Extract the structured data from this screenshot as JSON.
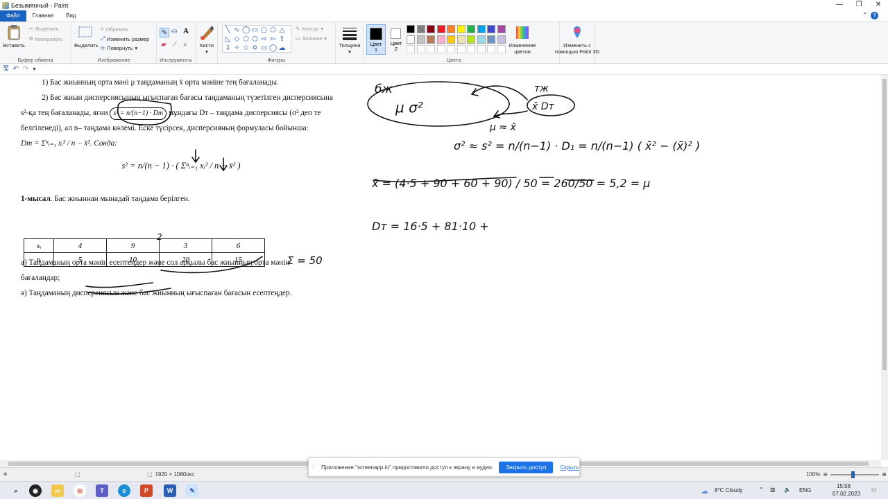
{
  "window": {
    "title": "Безымянный - Paint",
    "controls": [
      "—",
      "❐",
      "✕"
    ]
  },
  "menu": {
    "file": "Файл",
    "home": "Главная",
    "view": "Вид",
    "help": "?"
  },
  "ribbon": {
    "clipboard": {
      "label": "Буфер обмена",
      "paste": "Вставить",
      "cut": "Вырезать",
      "copy": "Копировать"
    },
    "image": {
      "label": "Изображение",
      "select": "Выделить",
      "crop": "Обрезать",
      "resize": "Изменить размер",
      "rotate": "Повернуть"
    },
    "tools": {
      "label": "Инструменты"
    },
    "brushes": {
      "label": "Кисти"
    },
    "shapes": {
      "label": "Фигуры",
      "outline": "Контур",
      "fill": "Заливка"
    },
    "size": {
      "label": "Толщина"
    },
    "color1": {
      "label": "Цвет\n1",
      "line1": "Цвет",
      "line2": "1"
    },
    "color2": {
      "line1": "Цвет",
      "line2": "2"
    },
    "colors": {
      "label": "Цвета",
      "edit_line1": "Изменение",
      "edit_line2": "цветов"
    },
    "paint3d": {
      "line1": "Изменить с",
      "line2": "помощью Paint 3D"
    },
    "palette": [
      "#000000",
      "#7f7f7f",
      "#880015",
      "#ed1c24",
      "#ff7f27",
      "#fff200",
      "#22b14c",
      "#00a2e8",
      "#3f48cc",
      "#a349a4",
      "#ffffff",
      "#c3c3c3",
      "#b97a57",
      "#ffaec9",
      "#ffc90e",
      "#efe4b0",
      "#b5e61d",
      "#99d9ea",
      "#7092be",
      "#c8bfe7"
    ]
  },
  "document": {
    "p1": "1)  Бас жиынның  орта мәні μ таңдаманың  x̄ орта мәніне тең бағаланады.",
    "p2a": "2) Бас жиын дисперсиясының ығыспаған бағасы таңдаманың түзетілген дисперсиясына",
    "p2b_pre": "s²-қа тең бағаланады, яғни ",
    "p2b_formula": "s² = n/(n−1) · Dт",
    "p2b_post": " мұндағы Dт – таңдама дисперсиясы (σ² деп те",
    "p2c": "белгіленеді), ал n– таңдама көлемі. Еске түсірсек, дисперсияның формуласы бойынша:",
    "p2d": "Dт = Σⁿᵢ₌₁ xᵢ² / n − x̄². Сонда:",
    "formula": "s² = n/(n − 1) · ( Σⁿᵢ₌₁ xᵢ² / n − x̄² )",
    "example_bold": "1-мысал",
    "example_rest": ". Бас жиыннан мынадай таңдама берілген.",
    "table": {
      "row1": [
        "xᵢ",
        "4",
        "9",
        "3",
        "6"
      ],
      "row2": [
        "nᵢ",
        "5",
        "10",
        "20",
        "15"
      ]
    },
    "qa": "а)  Таңдаманың орта мәнін есептеңдер және сол арқылы бас жиынның орта мәнін",
    "qa2": "бағалаңдар;",
    "qb": "ә) Таңдаманың дисперсиясын және бас жиынның ығыспаған бағасын есептеңдер."
  },
  "handwriting": {
    "bzh": "бж",
    "tzh": "тж",
    "mu_sigma": "μ  σ²",
    "xbar_dt": "x̄  Dт",
    "mu_eq": "μ ≈ x̄",
    "sigma_eq": "σ² ≈ s² = n/(n−1) · D₁ = n/(n−1) ( x̄² − (x̄)² )",
    "xbar_eq": "x̄ = (4·5 + 90 + 60 + 90) / 50 = 260/50 = 5,2 = μ",
    "dt_eq": "Dт = 16·5 + 81·10 +",
    "sum": "Σ = 50",
    "two": "2"
  },
  "status": {
    "dimensions": "1920 × 1080пкс",
    "zoom": "100%"
  },
  "notification": {
    "text": "Приложение \"screenapp.io\" предоставило доступ к экрану и аудио.",
    "button": "Закрыть доступ",
    "link": "Скрыть"
  },
  "taskbar": {
    "weather": "8°C  Cloudy",
    "lang": "ENG",
    "time": "15:56",
    "date": "07.02.2023"
  }
}
